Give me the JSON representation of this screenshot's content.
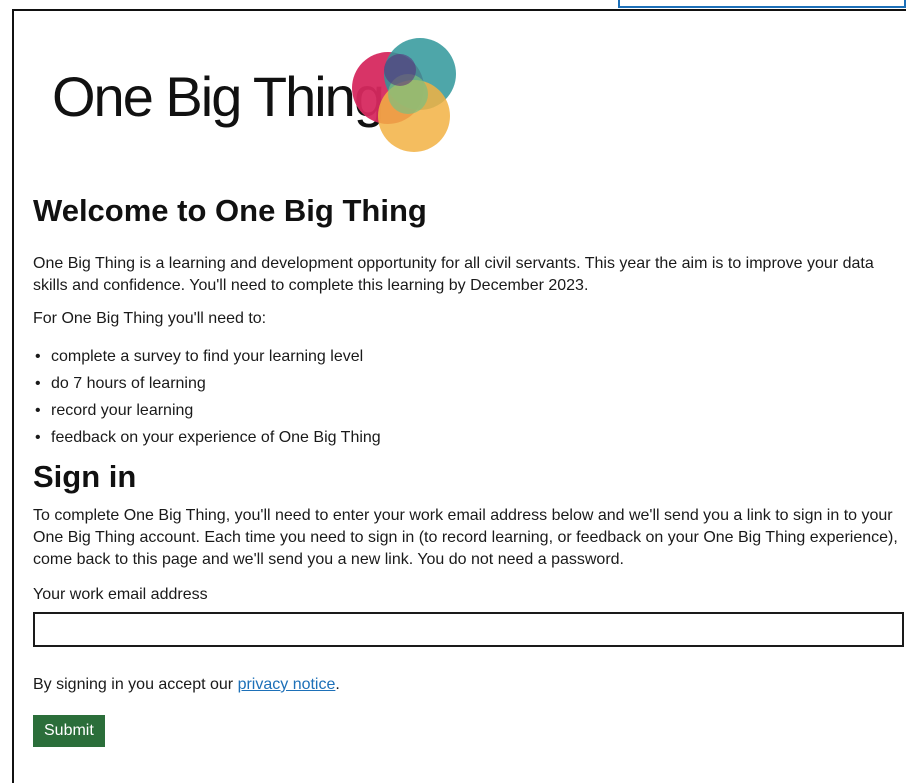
{
  "brand": {
    "name": "One Big Thing",
    "colors": {
      "pink": "#d6295f",
      "teal": "#2f979a",
      "green": "#7cbf7f",
      "yellow": "#f2b243",
      "purple": "#5a2a7a"
    }
  },
  "colors": {
    "link": "#1d70b8",
    "submit_bg": "#2b6e3a",
    "text": "#1a1a1a"
  },
  "welcome": {
    "title": "Welcome to One Big Thing",
    "intro": "One Big Thing is a learning and development opportunity for all civil servants. This year the aim is to improve your data skills and confidence. You'll need to complete this learning by December 2023.",
    "need_lead": "For One Big Thing you'll need to:",
    "need_items": [
      "complete a survey to find your learning level",
      "do 7 hours of learning",
      "record your learning",
      "feedback on your experience of One Big Thing"
    ]
  },
  "signin": {
    "title": "Sign in",
    "text": "To complete One Big Thing, you'll need to enter your work email address below and we'll send you a link to sign in to your One Big Thing account. Each time you need to sign in (to record learning, or feedback on your One Big Thing experience), come back to this page and we'll send you a new link. You do not need a password.",
    "email_label": "Your work email address",
    "email_value": "",
    "privacy_prefix": "By signing in you accept our ",
    "privacy_link": "privacy notice",
    "privacy_suffix": ".",
    "submit_label": "Submit"
  }
}
